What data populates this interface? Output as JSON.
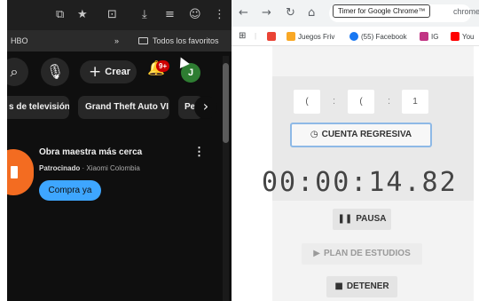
{
  "left_browser": {
    "bookmarks": {
      "hbo": "HBO",
      "overflow": "»",
      "folder": "Todos los favoritos"
    },
    "header": {
      "create_label": "Crear",
      "notification_count": "9+",
      "avatar_initial": "J"
    },
    "chips": {
      "chip1": "s de televisión",
      "chip2": "Grand Theft Auto VI",
      "chip3": "Pe"
    },
    "ad": {
      "title": "Obra maestra más cerca",
      "sponsored": "Patrocinado",
      "advertiser": " · Xiaomi Colombia",
      "cta": "Compra ya"
    }
  },
  "right_browser": {
    "tab_title": "Timer for Google Chrome™",
    "url_fragment": "chrome",
    "bookmarks": {
      "juegos": "Juegos Friv",
      "facebook": "(55) Facebook",
      "ig": "IG",
      "youtube": "You"
    },
    "timer": {
      "hours": "(",
      "minutes": "(",
      "seconds": "1",
      "colon": ":",
      "mode_button": "CUENTA REGRESIVA",
      "display": "00:00:14.82",
      "pause": "PAUSA",
      "plan": "PLAN DE ESTUDIOS",
      "stop": "DETENER"
    }
  },
  "colors": {
    "youtube_dark": "#0f0f0f",
    "accent_blue": "#3ea6ff",
    "notification_red": "#cc0000",
    "avatar_green": "#2e7d32",
    "timer_panel": "#f3f3f3",
    "focus_ring": "#8eb9e6"
  }
}
